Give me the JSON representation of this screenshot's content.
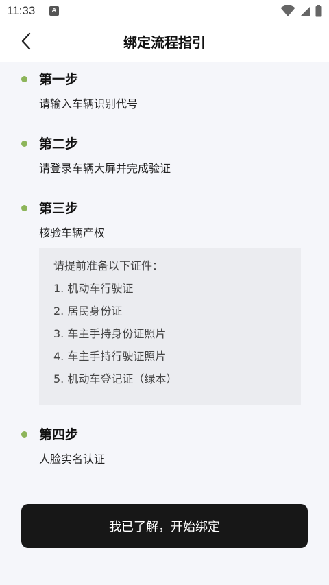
{
  "status_bar": {
    "time": "11:33",
    "notification_icon_letter": "A",
    "icons": [
      "wifi-icon",
      "cell-signal-icon",
      "battery-icon"
    ]
  },
  "header": {
    "title": "绑定流程指引",
    "back_icon": "chevron-left-icon"
  },
  "steps": [
    {
      "title": "第一步",
      "desc": "请输入车辆识别代号"
    },
    {
      "title": "第二步",
      "desc": "请登录车辆大屏并完成验证"
    },
    {
      "title": "第三步",
      "desc": "核验车辆产权"
    },
    {
      "title": "第四步",
      "desc": "人脸实名认证"
    }
  ],
  "documents": {
    "intro": "请提前准备以下证件：",
    "items": [
      "1. 机动车行驶证",
      "2. 居民身份证",
      "3. 车主手持身份证照片",
      "4. 车主手持行驶证照片",
      "5. 机动车登记证（绿本）"
    ]
  },
  "confirm_button": {
    "label": "我已了解，开始绑定"
  },
  "colors": {
    "step_dot": "#8db55a",
    "button_bg": "#171717",
    "page_bg": "#f5f6fa",
    "doc_box_bg": "#ebecf0"
  }
}
